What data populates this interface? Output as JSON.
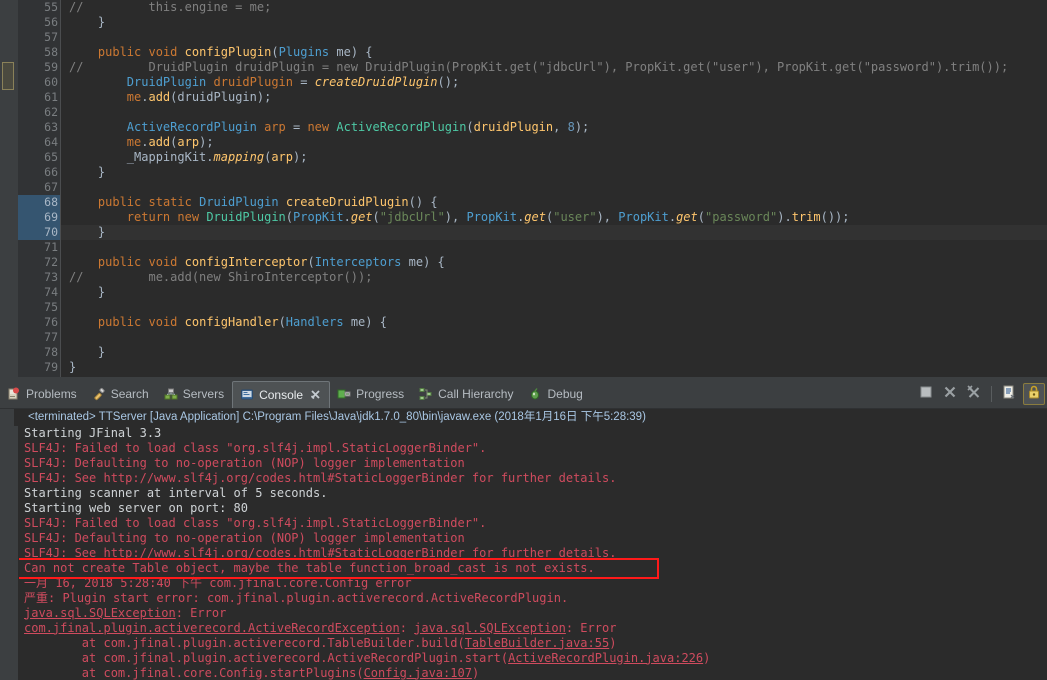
{
  "editor": {
    "first_line": 55,
    "lines": [
      {
        "n": 55,
        "tokens": [
          {
            "t": "//         this.engine = me;",
            "c": "cmt"
          }
        ],
        "fold": false,
        "ann": false
      },
      {
        "n": 56,
        "tokens": [
          {
            "t": "    }",
            "c": "plain"
          }
        ],
        "fold": false,
        "ann": false
      },
      {
        "n": 57,
        "tokens": [
          {
            "t": "",
            "c": "plain"
          }
        ],
        "fold": false,
        "ann": false
      },
      {
        "n": 58,
        "tokens": [
          {
            "t": "    ",
            "c": "plain"
          },
          {
            "t": "public",
            "c": "kw"
          },
          {
            "t": " ",
            "c": "plain"
          },
          {
            "t": "void",
            "c": "kw"
          },
          {
            "t": " ",
            "c": "plain"
          },
          {
            "t": "configPlugin",
            "c": "meth"
          },
          {
            "t": "(",
            "c": "plain"
          },
          {
            "t": "Plugins",
            "c": "type"
          },
          {
            "t": " me) {",
            "c": "plain"
          }
        ],
        "fold": true,
        "ann": true
      },
      {
        "n": 59,
        "tokens": [
          {
            "t": "//         DruidPlugin druidPlugin = new DruidPlugin(PropKit.get(\"jdbcUrl\"), PropKit.get(\"user\"), PropKit.get(\"password\").trim());",
            "c": "cmt"
          }
        ],
        "fold": false,
        "ann": false
      },
      {
        "n": 60,
        "tokens": [
          {
            "t": "        ",
            "c": "plain"
          },
          {
            "t": "DruidPlugin",
            "c": "type"
          },
          {
            "t": " ",
            "c": "plain"
          },
          {
            "t": "druidPlugin",
            "c": "kw"
          },
          {
            "t": " = ",
            "c": "plain"
          },
          {
            "t": "createDruidPlugin",
            "c": "methi"
          },
          {
            "t": "();",
            "c": "plain"
          }
        ],
        "fold": false,
        "ann": false
      },
      {
        "n": 61,
        "tokens": [
          {
            "t": "        ",
            "c": "plain"
          },
          {
            "t": "me",
            "c": "kw"
          },
          {
            "t": ".",
            "c": "plain"
          },
          {
            "t": "add",
            "c": "meth"
          },
          {
            "t": "(druidPlugin);",
            "c": "plain"
          }
        ],
        "fold": false,
        "ann": false
      },
      {
        "n": 62,
        "tokens": [
          {
            "t": "",
            "c": "plain"
          }
        ],
        "fold": false,
        "ann": false
      },
      {
        "n": 63,
        "tokens": [
          {
            "t": "        ",
            "c": "plain"
          },
          {
            "t": "ActiveRecordPlugin",
            "c": "type"
          },
          {
            "t": " ",
            "c": "plain"
          },
          {
            "t": "arp",
            "c": "kw"
          },
          {
            "t": " = ",
            "c": "plain"
          },
          {
            "t": "new",
            "c": "kw"
          },
          {
            "t": " ",
            "c": "plain"
          },
          {
            "t": "ActiveRecordPlugin",
            "c": "cls"
          },
          {
            "t": "(",
            "c": "plain"
          },
          {
            "t": "druidPlugin",
            "c": "meth"
          },
          {
            "t": ", ",
            "c": "plain"
          },
          {
            "t": "8",
            "c": "num2"
          },
          {
            "t": ");",
            "c": "plain"
          }
        ],
        "fold": false,
        "ann": false
      },
      {
        "n": 64,
        "tokens": [
          {
            "t": "        ",
            "c": "plain"
          },
          {
            "t": "me",
            "c": "kw"
          },
          {
            "t": ".",
            "c": "plain"
          },
          {
            "t": "add",
            "c": "meth"
          },
          {
            "t": "(",
            "c": "plain"
          },
          {
            "t": "arp",
            "c": "meth"
          },
          {
            "t": ");",
            "c": "plain"
          }
        ],
        "fold": false,
        "ann": false
      },
      {
        "n": 65,
        "tokens": [
          {
            "t": "        ",
            "c": "plain"
          },
          {
            "t": "_MappingKit",
            "c": "plain"
          },
          {
            "t": ".",
            "c": "plain"
          },
          {
            "t": "mapping",
            "c": "methi"
          },
          {
            "t": "(",
            "c": "plain"
          },
          {
            "t": "arp",
            "c": "meth"
          },
          {
            "t": ");",
            "c": "plain"
          }
        ],
        "fold": false,
        "ann": false
      },
      {
        "n": 66,
        "tokens": [
          {
            "t": "    }",
            "c": "plain"
          }
        ],
        "fold": false,
        "ann": false
      },
      {
        "n": 67,
        "tokens": [
          {
            "t": "",
            "c": "plain"
          }
        ],
        "fold": false,
        "ann": false
      },
      {
        "n": 68,
        "tokens": [
          {
            "t": "    ",
            "c": "plain"
          },
          {
            "t": "public",
            "c": "kw"
          },
          {
            "t": " ",
            "c": "plain"
          },
          {
            "t": "static",
            "c": "kw"
          },
          {
            "t": " ",
            "c": "plain"
          },
          {
            "t": "DruidPlugin",
            "c": "type"
          },
          {
            "t": " ",
            "c": "plain"
          },
          {
            "t": "createDruidPlugin",
            "c": "meth"
          },
          {
            "t": "() {",
            "c": "plain"
          }
        ],
        "fold": true,
        "ann": false,
        "selected": true
      },
      {
        "n": 69,
        "tokens": [
          {
            "t": "        ",
            "c": "plain"
          },
          {
            "t": "return",
            "c": "kw"
          },
          {
            "t": " ",
            "c": "plain"
          },
          {
            "t": "new",
            "c": "kw"
          },
          {
            "t": " ",
            "c": "plain"
          },
          {
            "t": "DruidPlugin",
            "c": "cls"
          },
          {
            "t": "(",
            "c": "plain"
          },
          {
            "t": "PropKit",
            "c": "type"
          },
          {
            "t": ".",
            "c": "plain"
          },
          {
            "t": "get",
            "c": "methi"
          },
          {
            "t": "(",
            "c": "plain"
          },
          {
            "t": "\"jdbcUrl\"",
            "c": "str"
          },
          {
            "t": "), ",
            "c": "plain"
          },
          {
            "t": "PropKit",
            "c": "type"
          },
          {
            "t": ".",
            "c": "plain"
          },
          {
            "t": "get",
            "c": "methi"
          },
          {
            "t": "(",
            "c": "plain"
          },
          {
            "t": "\"user\"",
            "c": "str"
          },
          {
            "t": "), ",
            "c": "plain"
          },
          {
            "t": "PropKit",
            "c": "type"
          },
          {
            "t": ".",
            "c": "plain"
          },
          {
            "t": "get",
            "c": "methi"
          },
          {
            "t": "(",
            "c": "plain"
          },
          {
            "t": "\"password\"",
            "c": "str"
          },
          {
            "t": ").",
            "c": "plain"
          },
          {
            "t": "trim",
            "c": "meth"
          },
          {
            "t": "());",
            "c": "plain"
          }
        ],
        "fold": false,
        "ann": false,
        "selected": true
      },
      {
        "n": 70,
        "tokens": [
          {
            "t": "    }",
            "c": "plain"
          }
        ],
        "fold": false,
        "ann": false,
        "selected": true,
        "current": true
      },
      {
        "n": 71,
        "tokens": [
          {
            "t": "",
            "c": "plain"
          }
        ],
        "fold": false,
        "ann": false
      },
      {
        "n": 72,
        "tokens": [
          {
            "t": "    ",
            "c": "plain"
          },
          {
            "t": "public",
            "c": "kw"
          },
          {
            "t": " ",
            "c": "plain"
          },
          {
            "t": "void",
            "c": "kw"
          },
          {
            "t": " ",
            "c": "plain"
          },
          {
            "t": "configInterceptor",
            "c": "meth"
          },
          {
            "t": "(",
            "c": "plain"
          },
          {
            "t": "Interceptors",
            "c": "type"
          },
          {
            "t": " me) {",
            "c": "plain"
          }
        ],
        "fold": true,
        "ann": true
      },
      {
        "n": 73,
        "tokens": [
          {
            "t": "//         me.add(new ShiroInterceptor());",
            "c": "cmt"
          }
        ],
        "fold": false,
        "ann": false
      },
      {
        "n": 74,
        "tokens": [
          {
            "t": "    }",
            "c": "plain"
          }
        ],
        "fold": false,
        "ann": false
      },
      {
        "n": 75,
        "tokens": [
          {
            "t": "",
            "c": "plain"
          }
        ],
        "fold": false,
        "ann": false
      },
      {
        "n": 76,
        "tokens": [
          {
            "t": "    ",
            "c": "plain"
          },
          {
            "t": "public",
            "c": "kw"
          },
          {
            "t": " ",
            "c": "plain"
          },
          {
            "t": "void",
            "c": "kw"
          },
          {
            "t": " ",
            "c": "plain"
          },
          {
            "t": "configHandler",
            "c": "meth"
          },
          {
            "t": "(",
            "c": "plain"
          },
          {
            "t": "Handlers",
            "c": "type"
          },
          {
            "t": " me) {",
            "c": "plain"
          }
        ],
        "fold": true,
        "ann": true
      },
      {
        "n": 77,
        "tokens": [
          {
            "t": "",
            "c": "plain"
          }
        ],
        "fold": false,
        "ann": false
      },
      {
        "n": 78,
        "tokens": [
          {
            "t": "    }",
            "c": "plain"
          }
        ],
        "fold": false,
        "ann": false
      },
      {
        "n": 79,
        "tokens": [
          {
            "t": "}",
            "c": "plain"
          }
        ],
        "fold": false,
        "ann": false
      }
    ]
  },
  "panel": {
    "tabs": [
      {
        "id": "problems",
        "label": "Problems",
        "icon": "problems-icon",
        "active": false,
        "closable": false
      },
      {
        "id": "search",
        "label": "Search",
        "icon": "search-icon",
        "active": false,
        "closable": false
      },
      {
        "id": "servers",
        "label": "Servers",
        "icon": "servers-icon",
        "active": false,
        "closable": false
      },
      {
        "id": "console",
        "label": "Console",
        "icon": "console-icon",
        "active": true,
        "closable": true
      },
      {
        "id": "progress",
        "label": "Progress",
        "icon": "progress-icon",
        "active": false,
        "closable": false
      },
      {
        "id": "call-hierarchy",
        "label": "Call Hierarchy",
        "icon": "call-hierarchy-icon",
        "active": false,
        "closable": false
      },
      {
        "id": "debug",
        "label": "Debug",
        "icon": "debug-icon",
        "active": false,
        "closable": false
      }
    ],
    "toolbar": [
      {
        "id": "terminate",
        "name": "terminate-button",
        "icon": "stop-square-icon"
      },
      {
        "id": "remove",
        "name": "remove-launch-button",
        "icon": "x-icon"
      },
      {
        "id": "remove-all",
        "name": "remove-all-terminated-button",
        "icon": "double-x-icon"
      },
      {
        "id": "open-console",
        "name": "open-console-button",
        "icon": "console-document-icon"
      },
      {
        "id": "pin",
        "name": "pin-console-button",
        "icon": "lock-icon"
      }
    ],
    "status": "<terminated> TTServer [Java Application] C:\\Program Files\\Java\\jdk1.7.0_80\\bin\\javaw.exe (2018年1月16日 下午5:28:39)"
  },
  "console": {
    "lines": [
      {
        "text": "Starting JFinal 3.3",
        "style": "out"
      },
      {
        "text": "SLF4J: Failed to load class \"org.slf4j.impl.StaticLoggerBinder\".",
        "style": "err"
      },
      {
        "text": "SLF4J: Defaulting to no-operation (NOP) logger implementation",
        "style": "err"
      },
      {
        "text": "SLF4J: See http://www.slf4j.org/codes.html#StaticLoggerBinder for further details.",
        "style": "err"
      },
      {
        "text": "Starting scanner at interval of 5 seconds.",
        "style": "out"
      },
      {
        "text": "Starting web server on port: 80",
        "style": "out"
      },
      {
        "text": "SLF4J: Failed to load class \"org.slf4j.impl.StaticLoggerBinder\".",
        "style": "err"
      },
      {
        "text": "SLF4J: Defaulting to no-operation (NOP) logger implementation",
        "style": "err"
      },
      {
        "text": "SLF4J: See http://www.slf4j.org/codes.html#StaticLoggerBinder for further details.",
        "style": "err-link"
      },
      {
        "text": "Can not create Table object, maybe the table function_broad_cast is not exists.",
        "style": "err",
        "highlighted": true
      },
      {
        "text": "一月 16, 2018 5:28:40 下午 com.jfinal.core.Config error",
        "style": "err"
      },
      {
        "text": "严重: Plugin start error: com.jfinal.plugin.activerecord.ActiveRecordPlugin.",
        "style": "err"
      },
      {
        "text": "java.sql.SQLException: Error",
        "style": "err-link-head"
      },
      {
        "text": "com.jfinal.plugin.activerecord.ActiveRecordException: java.sql.SQLException: Error",
        "style": "err-link-head2"
      },
      {
        "text": "        at com.jfinal.plugin.activerecord.TableBuilder.build(TableBuilder.java:55)",
        "style": "err-trace"
      },
      {
        "text": "        at com.jfinal.plugin.activerecord.ActiveRecordPlugin.start(ActiveRecordPlugin.java:226)",
        "style": "err-trace"
      },
      {
        "text": "        at com.jfinal.core.Config.startPlugins(Config.java:107)",
        "style": "err-trace"
      }
    ],
    "highlight_box": {
      "label": "error-highlight-box"
    }
  },
  "colors": {
    "editor_bg": "#2b2b2b",
    "gutter_bg": "#313335",
    "panel_bg": "#3c3f41",
    "error_red": "#cf4b5e",
    "highlight_red": "#ff1a1a",
    "selection_blue": "#355570",
    "status_blue": "#a9c7e4"
  }
}
